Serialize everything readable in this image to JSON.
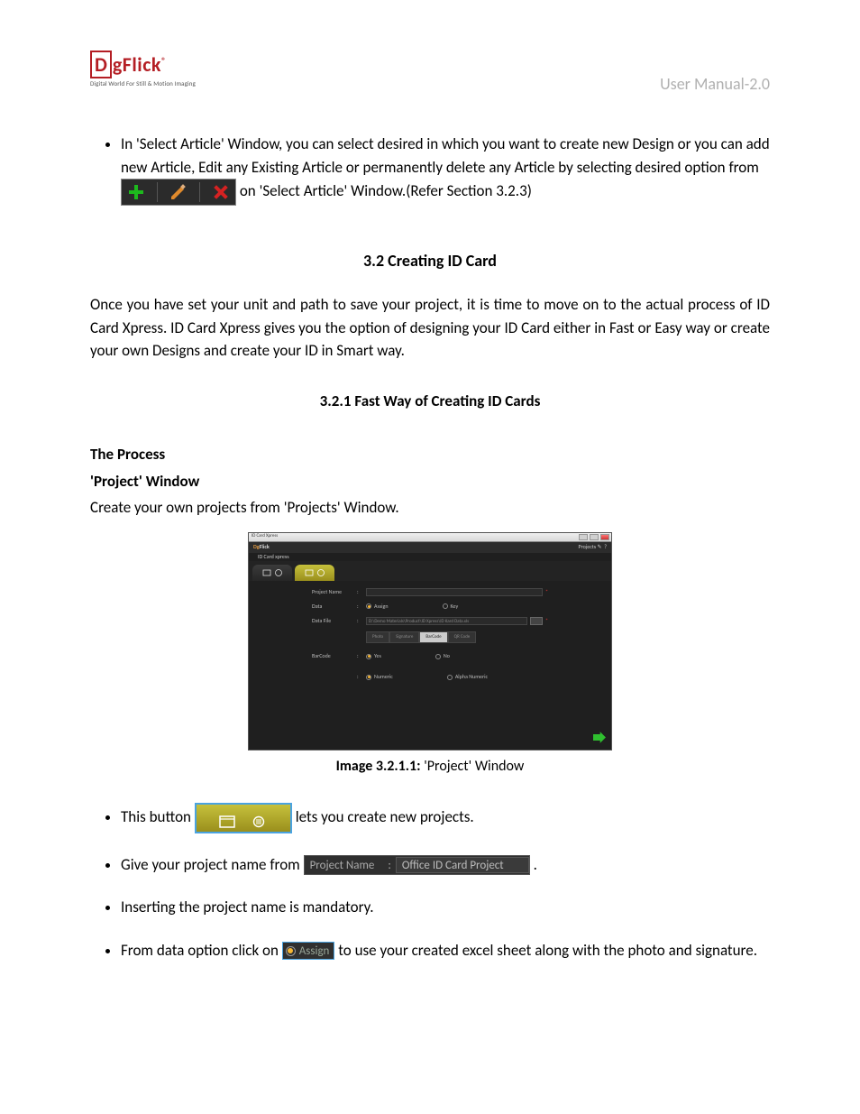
{
  "header": {
    "brand": "DgFlick",
    "brand_sub": "Digital World For Still & Motion Imaging",
    "manual": "User Manual-2.0"
  },
  "bullet1": {
    "part1": "In 'Select Article' Window, you can select desired in which you want to create new Design or you can add new Article, Edit any Existing Article or permanently delete any Article by selecting desired option from ",
    "part2": " on 'Select Article' Window.(Refer Section 3.2.3)"
  },
  "section_heading": "3.2 Creating ID Card",
  "section_body": "Once you have set your unit and path to save your project, it is time to move on to the actual process of ID Card Xpress. ID Card Xpress gives you the option of designing your ID Card either in Fast or Easy way or create your own Designs and create your ID in Smart way.",
  "subsection_heading": "3.2.1 Fast Way of Creating ID Cards",
  "process_heading": "The Process",
  "project_window_heading": "'Project' Window",
  "project_window_body": "Create your own projects from 'Projects' Window.",
  "figure": {
    "caption_bold": "Image 3.2.1.1:",
    "caption_rest": " 'Project' Window",
    "window_title": "ID Card Xpress",
    "product_label": "ID Card xpress",
    "top_right": "Projects",
    "form": {
      "project_name": "Project Name",
      "data": "Data",
      "data_assign": "Assign",
      "data_key": "Key",
      "data_file": "Data File",
      "data_file_path": "D:\\Demo Materials\\Product\\ID Xpress\\ID Kard Data.xls",
      "subtabs": [
        "Photo",
        "Signature",
        "BarCode",
        "QR Code"
      ],
      "subtab_active": "BarCode",
      "barcode": "BarCode",
      "barcode_yes": "Yes",
      "barcode_no": "No",
      "numeric": "Numeric",
      "alphanumeric": "Alpha Numeric"
    }
  },
  "bullets": {
    "b2_a": "This button ",
    "b2_b": " lets you create new projects.",
    "b3_a": "Give your project name from ",
    "b3_pn_label": "Project Name",
    "b3_pn_value": "Office ID Card Project",
    "b3_b": ".",
    "b4": "Inserting the project name is mandatory.",
    "b5_a": "From data option click on ",
    "b5_assign": "Assign",
    "b5_b": " to use your created excel sheet along with the photo and signature."
  }
}
